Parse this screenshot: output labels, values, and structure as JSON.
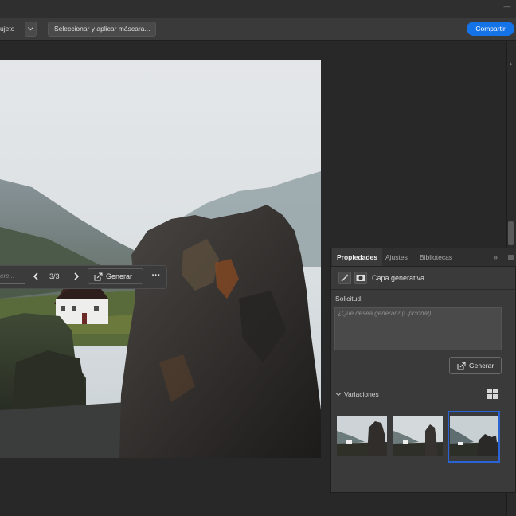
{
  "options_bar": {
    "subject_label": "ujeto",
    "select_mask_label": "Seleccionar y aplicar máscara...",
    "share_label": "Compartir"
  },
  "context_bar": {
    "prompt_placeholder": "ere...",
    "counter": "3/3",
    "generate_label": "Generar",
    "more_label": "···"
  },
  "panel": {
    "tabs": [
      "Propiedades",
      "Ajustes",
      "Bibliotecas"
    ],
    "layer_type": "Capa generativa",
    "prompt_label": "Solicitud:",
    "prompt_placeholder": "¿Qué desea generar? (Opcional)",
    "generate_label": "Generar",
    "variations_label": "Variaciones",
    "selected_variation": 3
  },
  "colors": {
    "accent": "#1473e6",
    "selection": "#2a63d6"
  },
  "icons": [
    "chevron-down-icon",
    "chevron-left-icon",
    "chevron-right-icon",
    "generate-icon",
    "more-icon",
    "collapse-icon",
    "menu-icon",
    "grid-icon",
    "magic-icon",
    "mask-icon"
  ]
}
